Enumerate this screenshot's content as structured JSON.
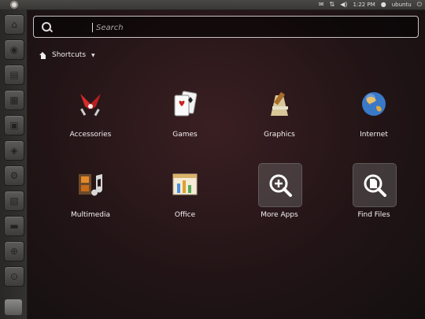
{
  "topbar": {
    "clock": "1:22 PM",
    "user": "ubuntu",
    "icons": [
      "mail-icon",
      "network-icon",
      "volume-icon",
      "power-icon"
    ]
  },
  "launcher": {
    "items": [
      "home-folder-icon",
      "firefox-icon",
      "document-icon",
      "spreadsheet-icon",
      "presentation-icon",
      "software-center-icon",
      "settings-icon",
      "workspaces-icon",
      "terminal-icon",
      "applications-icon",
      "files-icon"
    ]
  },
  "search": {
    "placeholder": "Search",
    "value": ""
  },
  "breadcrumb": {
    "label": "Shortcuts"
  },
  "grid": {
    "row1": [
      "Accessories",
      "Games",
      "Graphics",
      "Internet"
    ],
    "row2": [
      "Multimedia",
      "Office",
      "More Apps",
      "Find Files"
    ]
  }
}
